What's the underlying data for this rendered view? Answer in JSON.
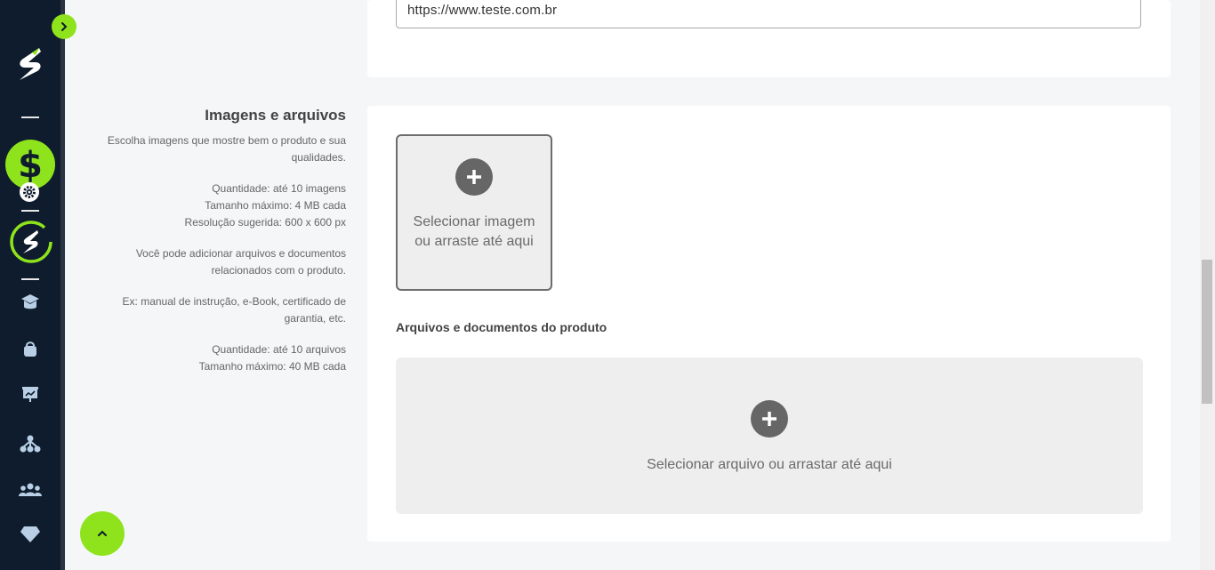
{
  "colors": {
    "sidebar_bg": "#0e1c2e",
    "accent": "#8fe31c",
    "dropzone_bg": "#eeeeee"
  },
  "sidebar": {
    "icons": [
      "chevron-right-icon",
      "brand-logo",
      "dollar-icon",
      "gear-icon",
      "account-logo-icon",
      "graduation-cap-icon",
      "bag-icon",
      "presentation-chart-icon",
      "network-icon",
      "users-icon",
      "diamond-icon"
    ]
  },
  "url_field": {
    "value": "https://www.teste.com.br"
  },
  "images_section": {
    "title": "Imagens e arquivos",
    "desc_intro": "Escolha imagens que mostre bem o produto e sua qualidades.",
    "image_quantity": "Quantidade: até 10 imagens",
    "image_max_size": "Tamanho máximo: 4 MB cada",
    "image_resolution": "Resolução sugerida: 600 x 600 px",
    "files_intro": "Você pode adicionar arquivos e documentos relacionados com o produto.",
    "files_example": "Ex: manual de instrução, e-Book, certificado de garantia, etc.",
    "files_quantity": "Quantidade: até 10 arquivos",
    "files_max_size": "Tamanho máximo: 40 MB cada"
  },
  "image_dropzone": {
    "label": "Selecionar imagem ou arraste até aqui"
  },
  "files_heading": "Arquivos e documentos do produto",
  "file_dropzone": {
    "label": "Selecionar arquivo ou arrastar até aqui"
  }
}
